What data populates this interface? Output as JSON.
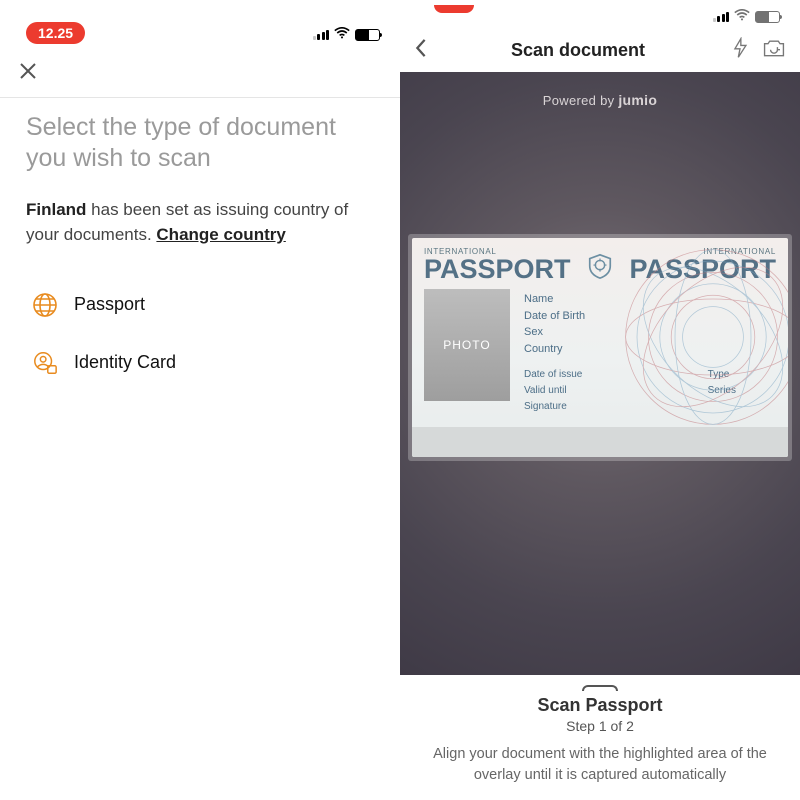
{
  "left": {
    "time": "12.25",
    "heading": "Select the type of document you wish to scan",
    "country": "Finland",
    "country_line_rest": " has been set as issuing country of your documents. ",
    "change_link": "Change country",
    "docs": [
      {
        "label": "Passport"
      },
      {
        "label": "Identity Card"
      }
    ]
  },
  "right": {
    "scanbar_title": "Scan document",
    "powered_prefix": "Powered by ",
    "powered_brand": "jumio",
    "passport": {
      "intl": "INTERNATIONAL",
      "big": "PASSPORT",
      "photo_label": "PHOTO",
      "fields": [
        "Name",
        "Date of Birth",
        "Sex",
        "Country"
      ],
      "meta_left": [
        "Date of issue",
        "Valid until",
        "Signature"
      ],
      "meta_right": [
        "Type",
        "Series"
      ]
    },
    "bottom": {
      "title": "Scan Passport",
      "step": "Step 1 of 2",
      "instr": "Align your document with the highlighted area of the overlay until it is captured automatically"
    }
  }
}
